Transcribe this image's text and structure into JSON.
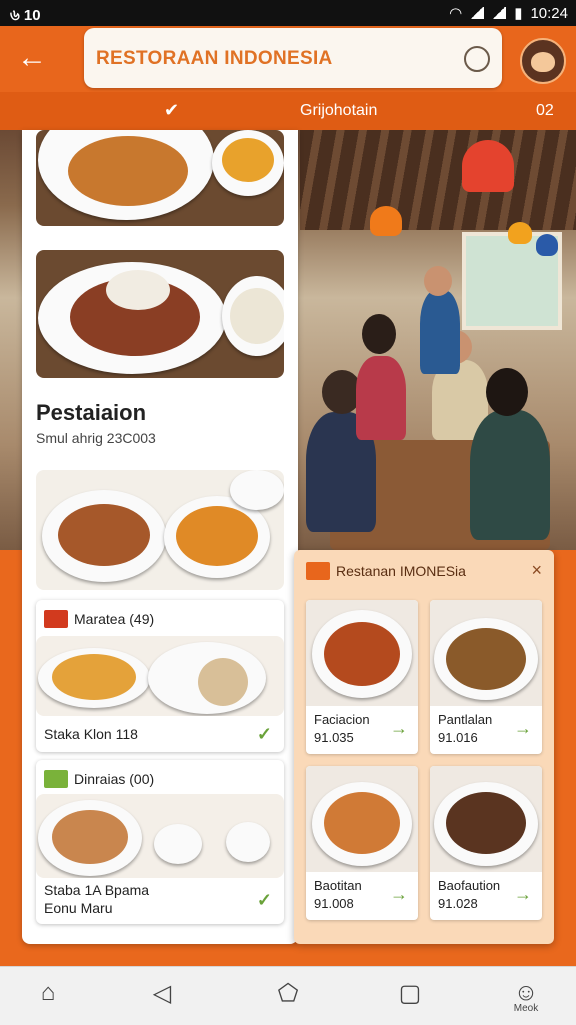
{
  "status_bar": {
    "left": "৬ 10",
    "time": "10:24"
  },
  "app_bar": {
    "search_text": "RESTORAAN INDONESIA"
  },
  "tab_bar": {
    "title": "Grijohotain",
    "right": "02"
  },
  "left_panel": {
    "section_title": "Pestaiaion",
    "section_subtitle": "Smul ahrig  23C003",
    "cards": [
      {
        "header": "Maratea (49)",
        "footer": "Staka Klon 118"
      },
      {
        "header": "Dinraias (00)",
        "footer_line1": "Staba 1A Bpama",
        "footer_line2": "Eonu Maru"
      }
    ]
  },
  "popup": {
    "title": "Restanan IMONESia",
    "items": [
      {
        "name": "Faciacion",
        "price": "91.035"
      },
      {
        "name": "Pantlalan",
        "price": "91.016"
      },
      {
        "name": "Baotitan",
        "price": "91.008"
      },
      {
        "name": "Baofaution",
        "price": "91.028"
      }
    ]
  },
  "nav": {
    "profile_label": "Meok"
  },
  "colors": {
    "accent": "#e8661c",
    "accent_dark": "#df5c14",
    "popup_bg": "#fad9b8",
    "check": "#6aa23a"
  }
}
